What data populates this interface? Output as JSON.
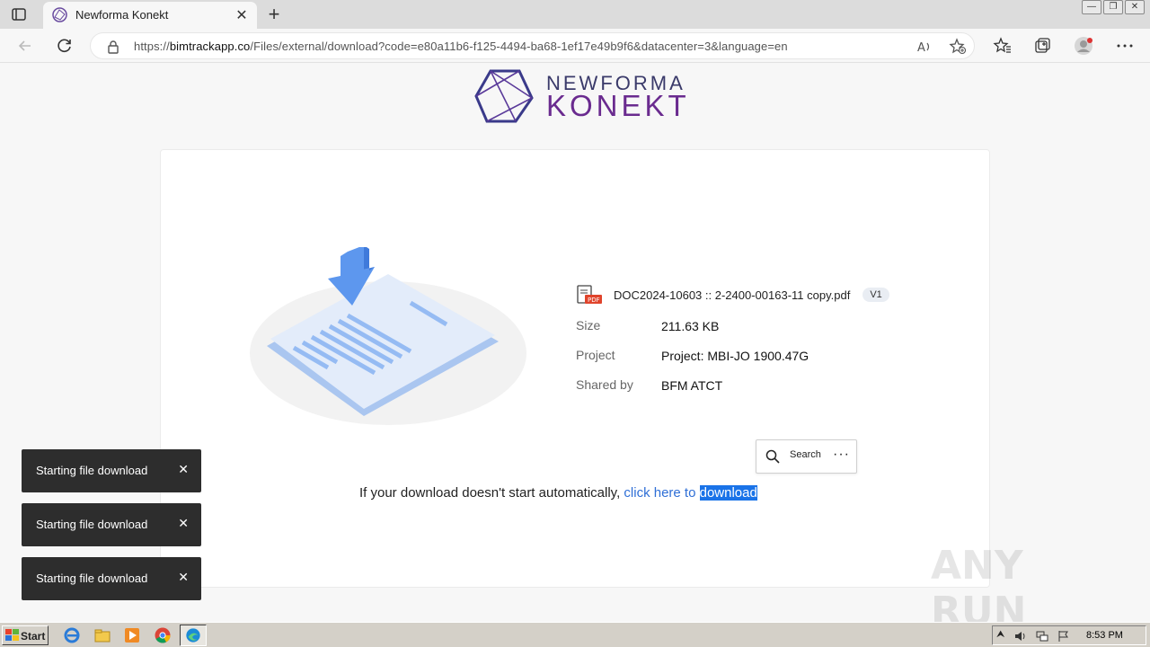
{
  "browser": {
    "tab_title": "Newforma Konekt",
    "tab_close": "✕",
    "new_tab": "+",
    "url_prefix": "https://",
    "url_host": "bimtrackapp.co",
    "url_rest": "/Files/external/download?code=e80a11b6-f125-4494-ba68-1ef17e49b9f6&datacenter=3&language=en"
  },
  "logo": {
    "line1": "NEWFORMA",
    "line2": "KONEKT",
    "colors": {
      "line1": "#3a3a6a",
      "line2": "#6a2b8f"
    }
  },
  "file": {
    "name": "DOC2024-10603 :: 2-2400-00163-11 copy.pdf",
    "version": "V1",
    "icon_badge": "PDF"
  },
  "meta": [
    {
      "label": "Size",
      "value": "211.63 KB"
    },
    {
      "label": "Project",
      "value": "Project: MBI-JO 1900.47G"
    },
    {
      "label": "Shared by",
      "value": "BFM ATCT"
    }
  ],
  "context_popup": {
    "search_label": "Search",
    "more": "···"
  },
  "download": {
    "prefix": "If your download doesn't start automatically, ",
    "link_part1": "click here to ",
    "link_part2": "download"
  },
  "toasts": [
    {
      "text": "Starting file download",
      "close": "✕"
    },
    {
      "text": "Starting file download",
      "close": "✕"
    },
    {
      "text": "Starting file download",
      "close": "✕"
    }
  ],
  "watermark": {
    "text": "ANY RUN"
  },
  "taskbar": {
    "start_label": "Start",
    "clock": "8:53 PM"
  },
  "colors": {
    "link": "#2f6fd6",
    "selection": "#1a73e8",
    "toast_bg": "#2d2d2d"
  }
}
